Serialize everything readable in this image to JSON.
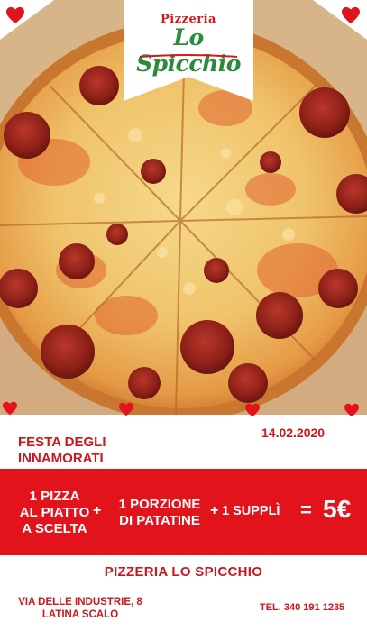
{
  "logo": {
    "top_text": "Pizzeria",
    "main_text": "Lo Spicchio"
  },
  "event": {
    "line1": "FESTA DEGLI",
    "line2": "INNAMORATI",
    "date": "14.02.2020"
  },
  "offer": {
    "item1_lines": [
      "1 PIZZA",
      "AL PIATTO",
      "A SCELTA"
    ],
    "plus": "+",
    "item2_lines": [
      "1 PORZIONE",
      "DI PATATINE"
    ],
    "item3": "1 SUPPLÌ",
    "equals": "=",
    "price": "5€"
  },
  "footer": {
    "name": "PIZZERIA LO SPICCHIO",
    "address_lines": [
      "VIA DELLE INDUSTRIE, 8",
      "LATINA SCALO"
    ],
    "phone": "TEL. 340 191 1235"
  },
  "colors": {
    "brand_red": "#e3131c",
    "text_red": "#c8181f",
    "logo_green": "#2a8c3a"
  },
  "icons": [
    "heart-icon"
  ]
}
